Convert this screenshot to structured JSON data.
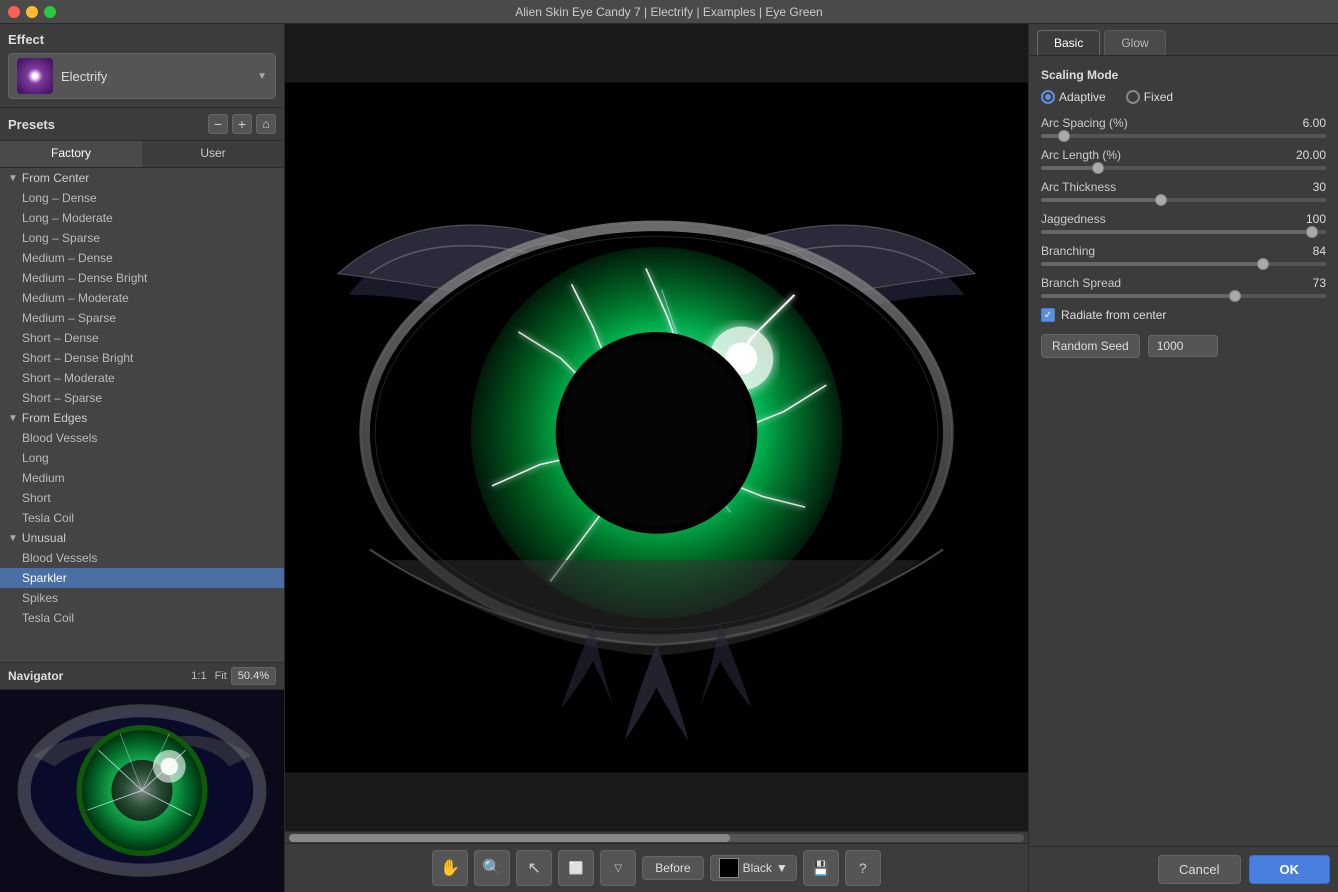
{
  "window": {
    "title": "Alien Skin Eye Candy 7 | Electrify | Examples | Eye Green"
  },
  "effect": {
    "label": "Effect",
    "name": "Electrify"
  },
  "presets": {
    "label": "Presets",
    "tabs": [
      {
        "id": "factory",
        "label": "Factory"
      },
      {
        "id": "user",
        "label": "User"
      }
    ],
    "groups": [
      {
        "name": "From Center",
        "items": [
          "Long – Dense",
          "Long – Moderate",
          "Long – Sparse",
          "Medium – Dense",
          "Medium – Dense Bright",
          "Medium – Moderate",
          "Medium – Sparse",
          "Short – Dense",
          "Short – Dense Bright",
          "Short – Moderate",
          "Short – Sparse"
        ]
      },
      {
        "name": "From Edges",
        "items": [
          "Blood Vessels",
          "Long",
          "Medium",
          "Short",
          "Tesla Coil"
        ]
      },
      {
        "name": "Unusual",
        "items": [
          "Blood Vessels",
          "Sparkler",
          "Spikes",
          "Tesla Coil"
        ]
      }
    ],
    "selected": "Sparkler"
  },
  "navigator": {
    "label": "Navigator",
    "zoom_1to1": "1:1",
    "zoom_fit": "Fit",
    "zoom_percent": "50.4%"
  },
  "right_panel": {
    "tabs": [
      {
        "id": "basic",
        "label": "Basic",
        "active": true
      },
      {
        "id": "glow",
        "label": "Glow"
      }
    ],
    "scaling_mode": {
      "label": "Scaling Mode",
      "options": [
        {
          "id": "adaptive",
          "label": "Adaptive",
          "checked": true
        },
        {
          "id": "fixed",
          "label": "Fixed",
          "checked": false
        }
      ]
    },
    "sliders": [
      {
        "id": "arc_spacing",
        "label": "Arc Spacing (%)",
        "value": "6.00",
        "percent": 8
      },
      {
        "id": "arc_length",
        "label": "Arc Length (%)",
        "value": "20.00",
        "percent": 20
      },
      {
        "id": "arc_thickness",
        "label": "Arc Thickness",
        "value": "30",
        "percent": 42
      },
      {
        "id": "jaggedness",
        "label": "Jaggedness",
        "value": "100",
        "percent": 95
      },
      {
        "id": "branching",
        "label": "Branching",
        "value": "84",
        "percent": 78
      },
      {
        "id": "branch_spread",
        "label": "Branch Spread",
        "value": "73",
        "percent": 68
      }
    ],
    "radiate_checkbox": {
      "label": "Radiate from center",
      "checked": true
    },
    "random_seed": {
      "btn_label": "Random Seed",
      "value": "1000"
    }
  },
  "toolbar": {
    "before_label": "Before",
    "bg_color_label": "Black",
    "bg_color_value": "Black"
  },
  "buttons": {
    "cancel": "Cancel",
    "ok": "OK"
  }
}
